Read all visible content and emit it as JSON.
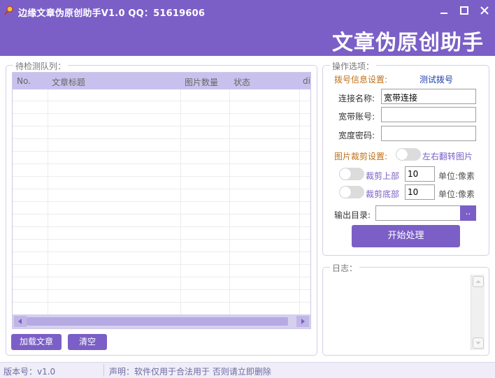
{
  "window": {
    "title": "边缘文章伪原创助手V1.0  QQ：51619606",
    "banner_title": "文章伪原创助手"
  },
  "queue": {
    "group_title": "待检测队列：",
    "columns": [
      "No.",
      "文章标题",
      "图片数量",
      "状态",
      "di"
    ],
    "rows": [],
    "load_button": "加载文章",
    "clear_button": "清空"
  },
  "options": {
    "group_title": "操作选项：",
    "dial_settings_label": "拨号信息设置:",
    "test_dial_link": "测试拨号",
    "connection_name_label": "连接名称:",
    "connection_name_value": "宽带连接",
    "account_label": "宽带账号:",
    "account_value": "",
    "password_label": "宽度密码:",
    "password_value": "",
    "crop_settings_label": "图片裁剪设置:",
    "flip_label": "左右翻转图片",
    "flip_enabled": false,
    "crop_top_label": "裁剪上部",
    "crop_top_enabled": false,
    "crop_top_value": "10",
    "crop_bottom_label": "裁剪底部",
    "crop_bottom_enabled": false,
    "crop_bottom_value": "10",
    "unit_label": "单位:像素",
    "output_dir_label": "输出目录:",
    "output_dir_value": "",
    "browse_button": "..",
    "start_button": "开始处理"
  },
  "log": {
    "group_title": "日志："
  },
  "status": {
    "version": "版本号：v1.0",
    "notice": "声明：软件仅用于合法用于 否则请立即删除"
  },
  "colors": {
    "accent": "#7b5fc7",
    "grid_header": "#c9c1ed",
    "orange_label": "#c07017",
    "blue_link": "#1a3ea8"
  }
}
